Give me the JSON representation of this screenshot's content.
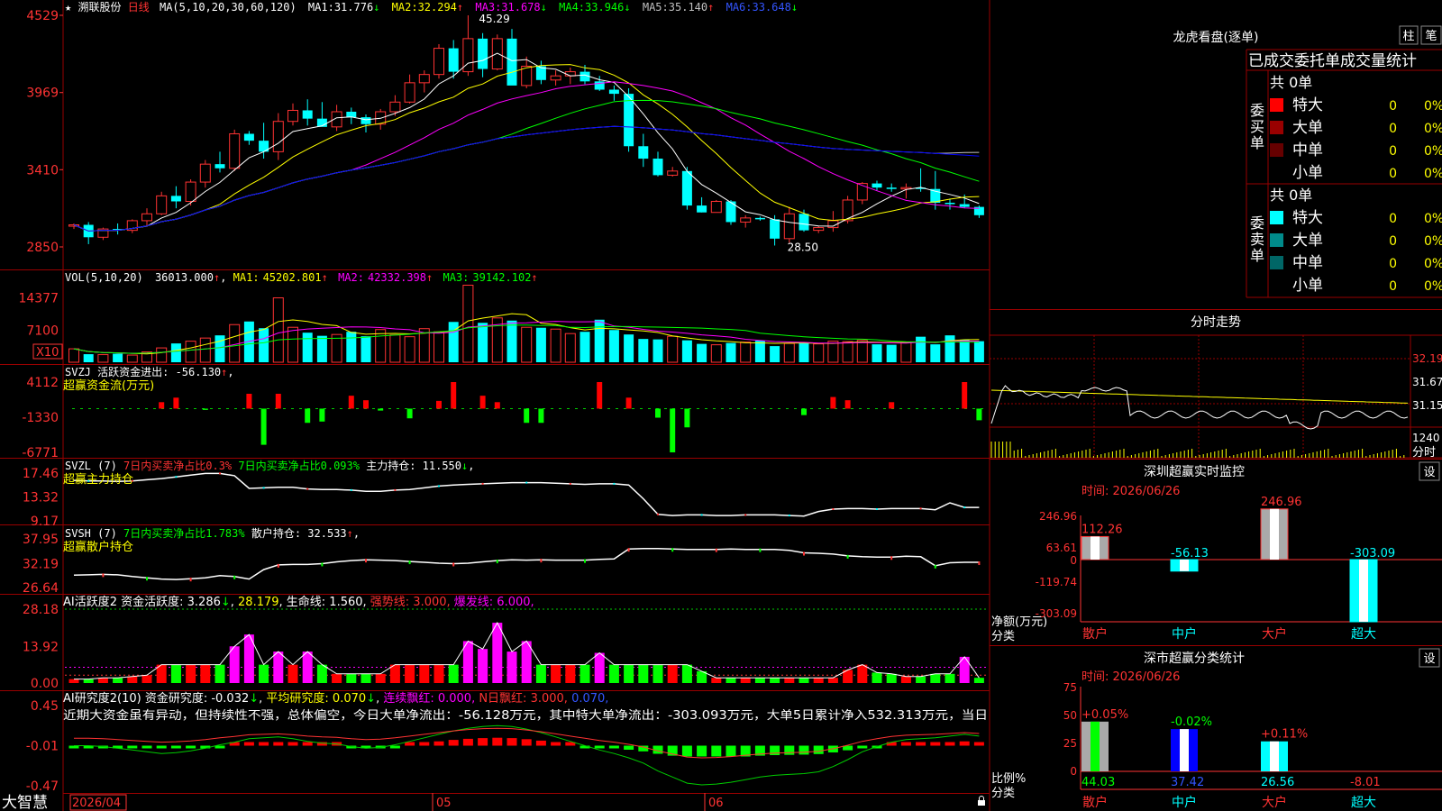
{
  "stock": {
    "star": "★",
    "name": "溯联股份",
    "period": "日线"
  },
  "price_header": {
    "ma_params": "MA(5,10,20,30,60,120)",
    "items": [
      {
        "label": "MA1:",
        "value": "31.776",
        "arrow": "↓",
        "color": "#ffffff"
      },
      {
        "label": "MA2:",
        "value": "32.294",
        "arrow": "↑",
        "color": "#ffff00"
      },
      {
        "label": "MA3:",
        "value": "31.678",
        "arrow": "↓",
        "color": "#ff00ff"
      },
      {
        "label": "MA4:",
        "value": "33.946",
        "arrow": "↓",
        "color": "#00ff00"
      },
      {
        "label": "MA5:",
        "value": "35.140",
        "arrow": "↑",
        "color": "#c0c0c0"
      },
      {
        "label": "MA6:",
        "value": "33.648",
        "arrow": "↓",
        "color": "#0000ff"
      }
    ]
  },
  "vol_header": {
    "params": "VOL(5,10,20)",
    "value": "36013.000",
    "items": [
      {
        "label": "MA1:",
        "value": "45202.801",
        "arrow": "↑",
        "color": "#ffff00"
      },
      {
        "label": "MA2:",
        "value": "42332.398",
        "arrow": "↑",
        "color": "#ff00ff"
      },
      {
        "label": "MA3:",
        "value": "39142.102",
        "arrow": "↑",
        "color": "#00ff00"
      }
    ],
    "multiplier": "X10"
  },
  "svzj_header": {
    "line1": "SVZJ  活跃资金进出: -56.130",
    "arrow": "↑",
    "line2": "超赢资金流(万元)"
  },
  "svzl_header": {
    "p1": "SVZL (7) ",
    "p2": "7日内买卖净占比0.3%",
    "p3": "7日内买卖净占比0.093%",
    "p4": "主力持仓: 11.550",
    "arrow": "↓",
    "line2": "超赢主力持仓"
  },
  "svsh_header": {
    "p1": "SVSH (7) ",
    "p2": "7日内买卖净占比1.783%",
    "p3": "散户持仓: 32.533",
    "arrow": "↑",
    "line2": "超赢散户持仓"
  },
  "ai1_header": {
    "p1": "AI活跃度2 资金活跃度: 3.286",
    "a1": "↓",
    "p2": "28.179",
    "p3": "生命线: 1.560",
    "p4": "强势线: 3.000",
    "p5": "爆发线: 6.000"
  },
  "ai2_header": {
    "p1": "AI研究度2(10) 资金研究度: -0.032",
    "a1": "↓",
    "p2": "平均研究度: 0.070",
    "p3": "连续飘红: 0.000",
    "p4": "N日飘红: 3.000",
    "p5": "0.070"
  },
  "commentary": "近期大资金虽有异动，但持续性不强，总体偏空，今日大单净流出：-56.128万元，其中特大单净流出：-303.093万元，大单5日累计净入532.313万元，当日",
  "footer": {
    "brand": "大智慧",
    "date_label": "2026/04",
    "month1": "05",
    "month2": "06"
  },
  "axis_labels": {
    "price": [
      "4529",
      "3969",
      "3410",
      "2850"
    ],
    "vol": [
      "14377",
      "7100"
    ],
    "svzj": [
      "4112",
      "-1330",
      "-6771"
    ],
    "svzl": [
      "17.46",
      "13.32",
      "9.17"
    ],
    "svsh": [
      "37.95",
      "32.19",
      "26.64"
    ],
    "ai1": [
      "28.18",
      "13.92",
      "0.00"
    ],
    "ai2": [
      "0.45",
      "-0.01",
      "-0.47"
    ]
  },
  "price_annotations": {
    "high": "45.29",
    "low": "28.50"
  },
  "dragon": {
    "title": "龙虎看盘(逐单)",
    "btn1": "柱",
    "btn2": "笔",
    "header": "已成交委托单成交量统计",
    "buy": {
      "side": "委买单",
      "total": "共 0单",
      "rows": [
        {
          "name": "特大",
          "count": "0",
          "pct": "0%",
          "color": "#ff0000"
        },
        {
          "name": "大单",
          "count": "0",
          "pct": "0%",
          "color": "#990000"
        },
        {
          "name": "中单",
          "count": "0",
          "pct": "0%",
          "color": "#660000"
        },
        {
          "name": "小单",
          "count": "0",
          "pct": "0%",
          "color": "#000000"
        }
      ]
    },
    "sell": {
      "side": "委卖单",
      "total": "共 0单",
      "rows": [
        {
          "name": "特大",
          "count": "0",
          "pct": "0%",
          "color": "#00ffff"
        },
        {
          "name": "大单",
          "count": "0",
          "pct": "0%",
          "color": "#008b8b"
        },
        {
          "name": "中单",
          "count": "0",
          "pct": "0%",
          "color": "#006666"
        },
        {
          "name": "小单",
          "count": "0",
          "pct": "0%",
          "color": "#000000"
        }
      ]
    }
  },
  "intraday": {
    "title": "分时走势",
    "labels": [
      "32.19",
      "31.67",
      "31.15",
      "1240",
      "分时"
    ]
  },
  "monitor1": {
    "title": "深圳超赢实时监控",
    "btn": "设",
    "time": "时间: 2026/06/26",
    "ylabels": [
      "246.96",
      "63.61",
      "0",
      "-119.74",
      "-303.09"
    ],
    "ylabel_unit": "净额(万元)",
    "xlabel_cat": "分类"
  },
  "monitor2": {
    "title": "深市超赢分类统计",
    "btn": "设",
    "time": "时间: 2026/06/26",
    "ylabels": [
      "75",
      "50",
      "25",
      "0"
    ],
    "ylabel_unit": "比例%",
    "xlabel_cat": "分类"
  },
  "chart_data": [
    {
      "type": "candlestick",
      "name": "溯联股份 日线",
      "ylim": [
        28.5,
        45.29
      ],
      "y_ticks": [
        45.29,
        39.69,
        34.1,
        28.5
      ],
      "ohlc": [
        [
          30.0,
          30.2,
          29.8,
          30.1
        ],
        [
          30.1,
          30.3,
          28.7,
          29.2
        ],
        [
          29.2,
          29.9,
          29.0,
          29.8
        ],
        [
          29.8,
          30.2,
          29.4,
          29.7
        ],
        [
          29.7,
          30.5,
          29.5,
          30.4
        ],
        [
          30.4,
          31.3,
          30.0,
          30.9
        ],
        [
          30.9,
          32.5,
          30.8,
          32.2
        ],
        [
          32.2,
          32.9,
          31.3,
          31.8
        ],
        [
          31.8,
          33.4,
          31.5,
          33.2
        ],
        [
          33.2,
          34.8,
          32.8,
          34.5
        ],
        [
          34.5,
          35.4,
          33.9,
          34.2
        ],
        [
          34.2,
          37.0,
          34.0,
          36.7
        ],
        [
          36.7,
          36.9,
          35.9,
          36.2
        ],
        [
          36.2,
          37.5,
          34.9,
          35.4
        ],
        [
          35.4,
          38.2,
          34.8,
          37.6
        ],
        [
          37.6,
          38.9,
          37.3,
          38.4
        ],
        [
          38.4,
          39.2,
          37.3,
          37.8
        ],
        [
          37.8,
          39.0,
          37.3,
          37.2
        ],
        [
          37.2,
          38.8,
          36.9,
          38.3
        ],
        [
          38.3,
          38.6,
          37.4,
          37.9
        ],
        [
          37.9,
          38.1,
          36.8,
          37.4
        ],
        [
          37.4,
          38.5,
          37.0,
          38.3
        ],
        [
          38.3,
          39.5,
          38.0,
          39.0
        ],
        [
          39.0,
          41.0,
          38.9,
          40.4
        ],
        [
          40.4,
          41.3,
          39.7,
          41.0
        ],
        [
          41.0,
          43.2,
          40.7,
          42.9
        ],
        [
          42.9,
          43.5,
          40.7,
          41.2
        ],
        [
          41.2,
          45.29,
          40.9,
          43.6
        ],
        [
          43.6,
          44.0,
          40.8,
          41.4
        ],
        [
          41.4,
          43.9,
          41.3,
          43.6
        ],
        [
          43.6,
          44.3,
          40.9,
          40.2
        ],
        [
          40.2,
          42.3,
          40.0,
          41.6
        ],
        [
          41.6,
          42.0,
          40.3,
          40.6
        ],
        [
          40.6,
          41.3,
          40.2,
          40.9
        ],
        [
          40.9,
          41.5,
          40.3,
          41.2
        ],
        [
          41.2,
          41.7,
          40.3,
          40.5
        ],
        [
          40.5,
          40.9,
          39.8,
          39.9
        ],
        [
          39.9,
          40.2,
          39.1,
          39.6
        ],
        [
          39.6,
          40.0,
          35.4,
          35.8
        ],
        [
          35.8,
          36.7,
          34.3,
          34.9
        ],
        [
          34.9,
          35.4,
          33.6,
          33.7
        ],
        [
          33.7,
          34.3,
          33.6,
          34.0
        ],
        [
          34.0,
          34.3,
          31.2,
          31.5
        ],
        [
          31.5,
          32.1,
          31.0,
          31.0
        ],
        [
          31.0,
          31.9,
          31.0,
          31.8
        ],
        [
          31.8,
          31.9,
          30.1,
          30.3
        ],
        [
          30.3,
          30.8,
          29.9,
          30.6
        ],
        [
          30.6,
          30.7,
          30.4,
          30.5
        ],
        [
          30.5,
          30.8,
          28.6,
          29.1
        ],
        [
          29.1,
          31.4,
          28.8,
          30.9
        ],
        [
          30.9,
          31.2,
          29.6,
          29.7
        ],
        [
          29.7,
          30.0,
          29.5,
          29.9
        ],
        [
          29.9,
          31.1,
          29.6,
          30.4
        ],
        [
          30.4,
          32.2,
          30.2,
          31.9
        ],
        [
          31.9,
          33.2,
          31.6,
          33.1
        ],
        [
          33.1,
          33.3,
          32.6,
          32.8
        ],
        [
          32.8,
          33.1,
          32.5,
          32.7
        ],
        [
          32.7,
          33.1,
          32.0,
          32.8
        ],
        [
          32.8,
          34.2,
          32.5,
          32.7
        ],
        [
          32.7,
          34.0,
          31.2,
          31.7
        ],
        [
          31.7,
          32.0,
          31.2,
          31.6
        ],
        [
          31.6,
          32.3,
          31.3,
          31.4
        ],
        [
          31.4,
          31.5,
          30.6,
          30.8
        ]
      ]
    },
    {
      "type": "bar",
      "name": "VOL",
      "ylim": [
        0,
        14377
      ],
      "values": [
        3000,
        1800,
        1700,
        1900,
        1600,
        2300,
        3200,
        4200,
        4700,
        5400,
        6000,
        8400,
        9100,
        7600,
        14377,
        7800,
        6600,
        5900,
        6200,
        6800,
        5800,
        7300,
        6100,
        5700,
        7500,
        6800,
        9000,
        17200,
        8800,
        9900,
        9300,
        7800,
        7700,
        7400,
        6400,
        6800,
        9500,
        7200,
        6200,
        5200,
        5100,
        5800,
        4900,
        4100,
        3900,
        4300,
        4500,
        4800,
        3600,
        4200,
        4400,
        4100,
        4700,
        4600,
        4900,
        4000,
        3900,
        4400,
        5700,
        4000,
        6000,
        5000,
        4700
      ]
    },
    {
      "type": "bar",
      "name": "SVZJ 超赢资金流(万元)",
      "ylim": [
        -6771,
        4112
      ],
      "values": [
        0,
        0,
        0,
        0,
        0,
        0,
        1000,
        1700,
        0,
        -200,
        0,
        0,
        2300,
        -5600,
        2300,
        0,
        -2200,
        -2000,
        0,
        2000,
        1300,
        -300,
        0,
        -1500,
        0,
        1200,
        4112,
        0,
        2000,
        1000,
        0,
        -2200,
        -2200,
        0,
        0,
        0,
        4112,
        0,
        1700,
        0,
        -1400,
        -6771,
        -2900,
        0,
        0,
        0,
        0,
        0,
        0,
        0,
        -1000,
        0,
        1800,
        1300,
        0,
        0,
        1000,
        0,
        0,
        0,
        0,
        4112,
        -1800
      ]
    },
    {
      "type": "line",
      "name": "SVZL 超赢主力持仓",
      "ylim": [
        9.17,
        17.46
      ],
      "values": [
        16.2,
        16.1,
        16.1,
        16.0,
        16.1,
        16.3,
        16.5,
        16.8,
        17.1,
        17.4,
        17.4,
        17.0,
        14.8,
        14.9,
        15.0,
        15.0,
        14.7,
        14.6,
        14.6,
        14.5,
        14.3,
        14.3,
        14.5,
        14.6,
        14.9,
        15.2,
        15.4,
        15.5,
        15.6,
        15.7,
        15.8,
        15.8,
        15.8,
        15.7,
        15.6,
        15.5,
        15.6,
        15.6,
        15.4,
        13.0,
        10.3,
        10.1,
        10.2,
        10.2,
        10.1,
        10.1,
        10.2,
        10.2,
        10.2,
        10.1,
        10.0,
        10.8,
        11.2,
        11.3,
        11.3,
        11.2,
        11.3,
        11.3,
        11.3,
        11.1,
        12.3,
        11.5,
        11.5
      ]
    },
    {
      "type": "line",
      "name": "SVSH 超赢散户持仓",
      "ylim": [
        26.64,
        37.95
      ],
      "values": [
        29.5,
        29.6,
        29.7,
        29.6,
        29.2,
        28.9,
        28.6,
        28.5,
        28.7,
        28.9,
        29.4,
        29.2,
        28.6,
        30.8,
        31.9,
        32.0,
        32.0,
        32.2,
        32.6,
        32.9,
        33.1,
        33.0,
        32.9,
        32.7,
        32.5,
        32.3,
        32.2,
        32.3,
        32.6,
        32.9,
        33.1,
        33.0,
        33.1,
        33.0,
        33.0,
        33.0,
        33.2,
        33.3,
        35.6,
        35.7,
        35.7,
        35.6,
        35.5,
        35.5,
        35.5,
        35.6,
        35.5,
        35.5,
        35.5,
        35.3,
        34.7,
        34.6,
        34.4,
        34.0,
        33.8,
        33.7,
        33.7,
        33.9,
        33.8,
        31.7,
        32.4,
        32.5,
        32.5
      ]
    },
    {
      "type": "bar",
      "name": "AI活跃度2 资金活跃度",
      "ylim": [
        0,
        28.18
      ],
      "values": [
        1.5,
        1.5,
        2.0,
        2.0,
        2.5,
        3.0,
        7.0,
        7.0,
        7.0,
        7.0,
        7.0,
        14.0,
        18.5,
        7.0,
        12.0,
        7.0,
        12.0,
        7.0,
        3.5,
        3.5,
        3.5,
        3.5,
        7.0,
        7.0,
        7.0,
        7.0,
        7.0,
        16.0,
        13.0,
        23.0,
        12.0,
        16.0,
        7.0,
        7.0,
        7.0,
        7.0,
        11.5,
        7.0,
        7.0,
        7.0,
        7.0,
        7.0,
        7.0,
        4.5,
        2.0,
        2.0,
        2.0,
        2.0,
        2.0,
        2.0,
        2.0,
        2.0,
        2.0,
        5.0,
        7.0,
        4.0,
        3.5,
        2.5,
        2.5,
        3.5,
        3.5,
        10.0,
        2.0,
        2.0
      ]
    },
    {
      "type": "line",
      "name": "AI研究度2 资金研究度",
      "ylim": [
        -0.47,
        0.45
      ],
      "values": [
        -0.01,
        -0.01,
        -0.02,
        -0.04,
        -0.06,
        -0.08,
        -0.1,
        -0.09,
        -0.07,
        -0.04,
        0.0,
        0.03,
        0.07,
        0.08,
        0.09,
        0.07,
        0.04,
        0.02,
        0.01,
        -0.02,
        -0.04,
        -0.03,
        0.0,
        0.04,
        0.08,
        0.12,
        0.16,
        0.19,
        0.21,
        0.22,
        0.21,
        0.18,
        0.14,
        0.09,
        0.04,
        -0.01,
        -0.06,
        -0.1,
        -0.15,
        -0.21,
        -0.3,
        -0.37,
        -0.44,
        -0.46,
        -0.45,
        -0.43,
        -0.4,
        -0.37,
        -0.35,
        -0.34,
        -0.33,
        -0.31,
        -0.25,
        -0.17,
        -0.08,
        -0.02,
        0.03,
        0.06,
        0.07,
        0.08,
        0.1,
        0.12,
        0.1
      ]
    }
  ]
}
